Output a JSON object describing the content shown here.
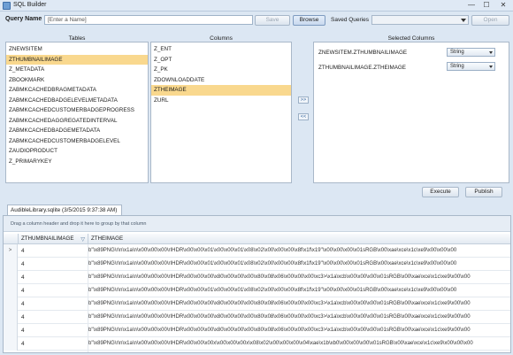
{
  "window": {
    "title": "SQL Builder",
    "minimize": "—",
    "maximize": "☐",
    "close": "✕"
  },
  "query": {
    "label": "Query Name",
    "placeholder": "[Enter a Name]",
    "save": "Save",
    "browse": "Browse",
    "saved_label": "Saved Queries",
    "open": "Open"
  },
  "tables": {
    "header": "Tables",
    "items": [
      "ZNEWSITEM",
      "ZTHUMBNAILIMAGE",
      "Z_METADATA",
      "ZBOOKMARK",
      "ZABMKCACHEDBRAGMETADATA",
      "ZABMKCACHEDBADGELEVELMETADATA",
      "ZABMKCACHEDCUSTOMERBADGEPROGRESS",
      "ZABMKCACHEDAGGREGATEDINTERVAL",
      "ZABMKCACHEDBADGEMETADATA",
      "ZABMKCACHEDCUSTOMERBADGELEVEL",
      "ZAUDIOPRODUCT",
      "Z_PRIMARYKEY"
    ],
    "selected_index": 1
  },
  "columns": {
    "header": "Columns",
    "items": [
      "Z_ENT",
      "Z_OPT",
      "Z_PK",
      "ZDOWNLOADDATE",
      "ZTHEIMAGE",
      "ZURL"
    ],
    "selected_index": 4
  },
  "move": {
    "add": ">>",
    "remove": "<<"
  },
  "selected": {
    "header": "Selected Columns",
    "rows": [
      {
        "name": "ZNEWSITEM.ZTHUMBNAILIMAGE",
        "type": "String"
      },
      {
        "name": "ZTHUMBNAILIMAGE.ZTHEIMAGE",
        "type": "String"
      }
    ]
  },
  "actions": {
    "execute": "Execute",
    "publish": "Publish"
  },
  "result_tab": "AudibleLibrary.sqlite (3/5/2015 9:37:38 AM)",
  "grid": {
    "group_hint": "Drag a column header and drop it here to group by that column",
    "col1": "ZTHUMBNAILIMAGE",
    "col2": "ZTHEIMAGE",
    "current_marker": ">",
    "rows": [
      {
        "c1": "4",
        "c2": "b\"\\x89PNG\\r\\n\\x1a\\n\\x00\\x00\\x00\\rIHDR\\x00\\x00\\x01\\x00\\x00\\x01\\x08\\x02\\x00\\x00\\x00\\x8f\\x1f\\x19\"\\x00\\x00\\x00\\x01sRGB\\x00\\xae\\xce\\x1c\\xe9\\x00\\x00\\x00"
      },
      {
        "c1": "4",
        "c2": "b\"\\x89PNG\\r\\n\\x1a\\n\\x00\\x00\\x00\\rIHDR\\x00\\x00\\x01\\x00\\x00\\x01\\x08\\x02\\x00\\x00\\x00\\x8f\\x1f\\x19\"\\x00\\x00\\x00\\x01sRGB\\x00\\xae\\xce\\x1c\\xe9\\x00\\x00\\x00"
      },
      {
        "c1": "4",
        "c2": "b\"\\x89PNG\\r\\n\\x1a\\n\\x00\\x00\\x00\\rIHDR\\x00\\x00\\x00\\x80\\x00\\x00\\x00\\x80\\x08\\x06\\x00\\x00\\x00\\xc3>\\x1a\\xcb\\x00\\x00\\x00\\x01sRGB\\x00\\xae\\xce\\x1c\\xe9\\x00\\x00"
      },
      {
        "c1": "4",
        "c2": "b\"\\x89PNG\\r\\n\\x1a\\n\\x00\\x00\\x00\\rIHDR\\x00\\x00\\x01\\x00\\x00\\x01\\x08\\x02\\x00\\x00\\x00\\x8f\\x1f\\x19\"\\x00\\x00\\x00\\x01sRGB\\x00\\xae\\xce\\x1c\\xe9\\x00\\x00\\x00"
      },
      {
        "c1": "4",
        "c2": "b\"\\x89PNG\\r\\n\\x1a\\n\\x00\\x00\\x00\\rIHDR\\x00\\x00\\x00\\x80\\x00\\x00\\x00\\x80\\x08\\x06\\x00\\x00\\x00\\xc3>\\x1a\\xcb\\x00\\x00\\x00\\x01sRGB\\x00\\xae\\xce\\x1c\\xe9\\x00\\x00"
      },
      {
        "c1": "4",
        "c2": "b\"\\x89PNG\\r\\n\\x1a\\n\\x00\\x00\\x00\\rIHDR\\x00\\x00\\x00\\x80\\x00\\x00\\x00\\x80\\x08\\x06\\x00\\x00\\x00\\xc3>\\x1a\\xcb\\x00\\x00\\x00\\x01sRGB\\x00\\xae\\xce\\x1c\\xe9\\x00\\x00"
      },
      {
        "c1": "4",
        "c2": "b\"\\x89PNG\\r\\n\\x1a\\n\\x00\\x00\\x00\\rIHDR\\x00\\x00\\x00\\x80\\x00\\x00\\x00\\x80\\x08\\x06\\x00\\x00\\x00\\xc3>\\x1a\\xcb\\x00\\x00\\x00\\x01sRGB\\x00\\xae\\xce\\x1c\\xe9\\x00\\x00"
      },
      {
        "c1": "4",
        "c2": "b\"\\x89PNG\\r\\n\\x1a\\n\\x00\\x00\\x00\\rIHDR\\x00\\x00\\x00x\\x00\\x00\\x00x\\x08\\x02\\x00\\x00\\x00\\x04\\xae\\x1b\\xb0\\x00\\x00\\x00\\x01sRGB\\x00\\xae\\xce\\x1c\\xe9\\x00\\x00\\x00"
      }
    ]
  },
  "colors": {
    "selection": "#f9d88e",
    "window_bg": "#dce7f3",
    "border": "#a9b8c9"
  }
}
